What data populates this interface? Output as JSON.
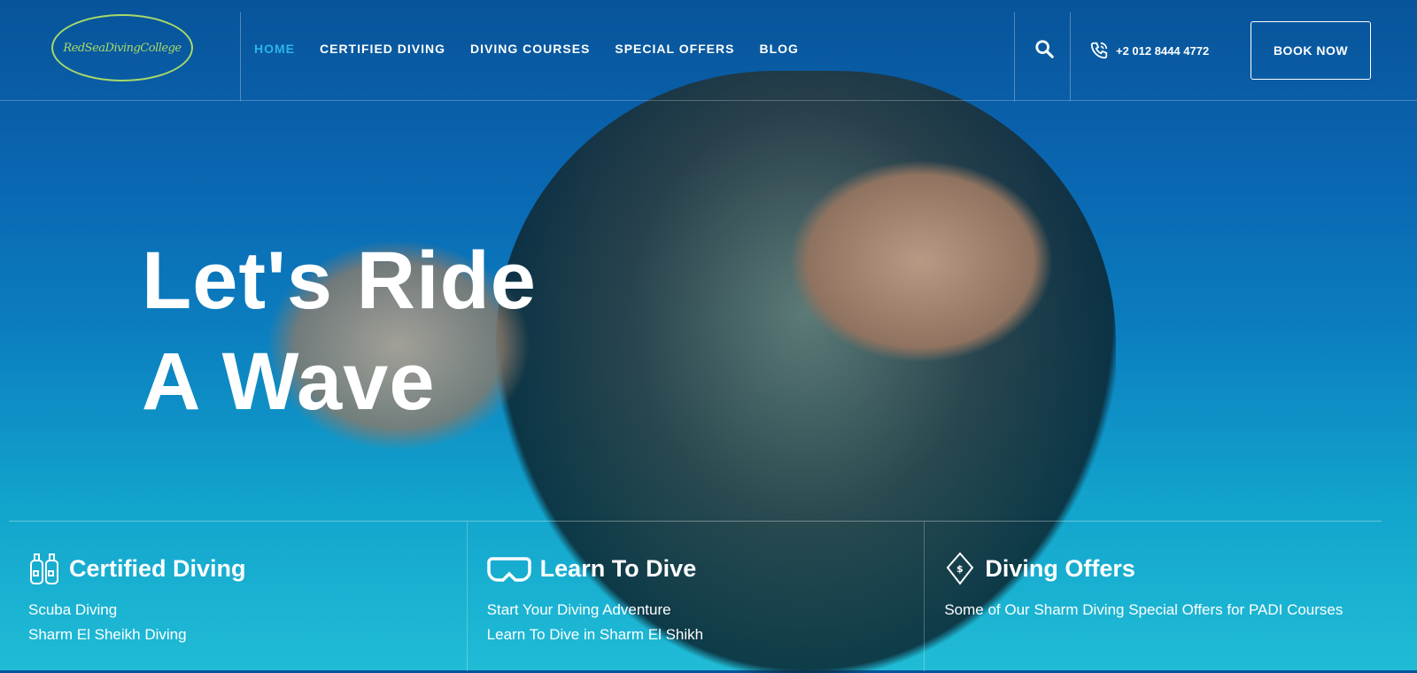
{
  "header": {
    "logo_text": "RedSeaDivingCollege",
    "nav": [
      {
        "label": "HOME",
        "active": true
      },
      {
        "label": "CERTIFIED DIVING"
      },
      {
        "label": "DIVING COURSES"
      },
      {
        "label": "SPECIAL OFFERS"
      },
      {
        "label": "BLOG"
      }
    ],
    "phone": "+2 012 8444 4772",
    "book_label": "BOOK NOW"
  },
  "hero": {
    "line1": "Let's Ride",
    "line2": "A Wave"
  },
  "panels": [
    {
      "icon": "tanks-icon",
      "title": "Certified Diving",
      "links": [
        "Scuba Diving",
        "Sharm El Sheikh Diving"
      ]
    },
    {
      "icon": "mask-icon",
      "title": "Learn To Dive",
      "links": [
        "Start Your Diving Adventure",
        "Learn To Dive in Sharm El Shikh"
      ]
    },
    {
      "icon": "offer-tag-icon",
      "title": "Diving Offers",
      "links": [
        "Some of Our Sharm Diving Special Offers for PADI Courses"
      ]
    }
  ]
}
